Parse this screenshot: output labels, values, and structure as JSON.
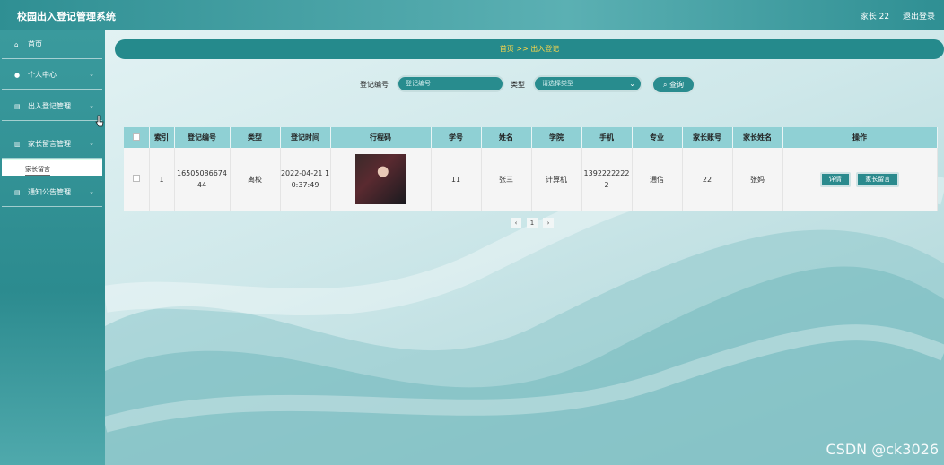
{
  "app": {
    "title": "校园出入登记管理系统"
  },
  "header": {
    "user_label": "家长 22",
    "logout_label": "退出登录"
  },
  "sidebar": {
    "items": [
      {
        "label": "首页",
        "icon": "home-icon"
      },
      {
        "label": "个人中心",
        "icon": "user-icon"
      },
      {
        "label": "出入登记管理",
        "icon": "clipboard-icon"
      },
      {
        "label": "家长留言管理",
        "icon": "bar-chart-icon"
      },
      {
        "label": "通知公告管理",
        "icon": "clipboard-icon"
      }
    ],
    "submenu": {
      "label": "家长留言"
    }
  },
  "breadcrumb": {
    "home": "首页",
    "sep": ">>",
    "current": "出入登记"
  },
  "search": {
    "reg_no_label": "登记编号",
    "reg_no_placeholder": "登记编号",
    "type_label": "类型",
    "type_placeholder": "请选择类型",
    "query_label": "查询"
  },
  "table": {
    "columns": [
      "",
      "索引",
      "登记编号",
      "类型",
      "登记时间",
      "行程码",
      "学号",
      "姓名",
      "学院",
      "手机",
      "专业",
      "家长账号",
      "家长姓名",
      "操作"
    ],
    "rows": [
      {
        "index": "1",
        "reg_no": "1650508667444",
        "type": "离校",
        "time": "2022-04-21 10:37:49",
        "student_no": "11",
        "name": "张三",
        "college": "计算机",
        "phone": "13922222222",
        "major": "通信",
        "parent_account": "22",
        "parent_name": "张妈",
        "actions": {
          "detail": "详情",
          "message": "家长留言"
        }
      }
    ]
  },
  "pagination": {
    "prev": "‹",
    "page": "1",
    "next": "›"
  },
  "watermark": "CSDN @ck3026"
}
